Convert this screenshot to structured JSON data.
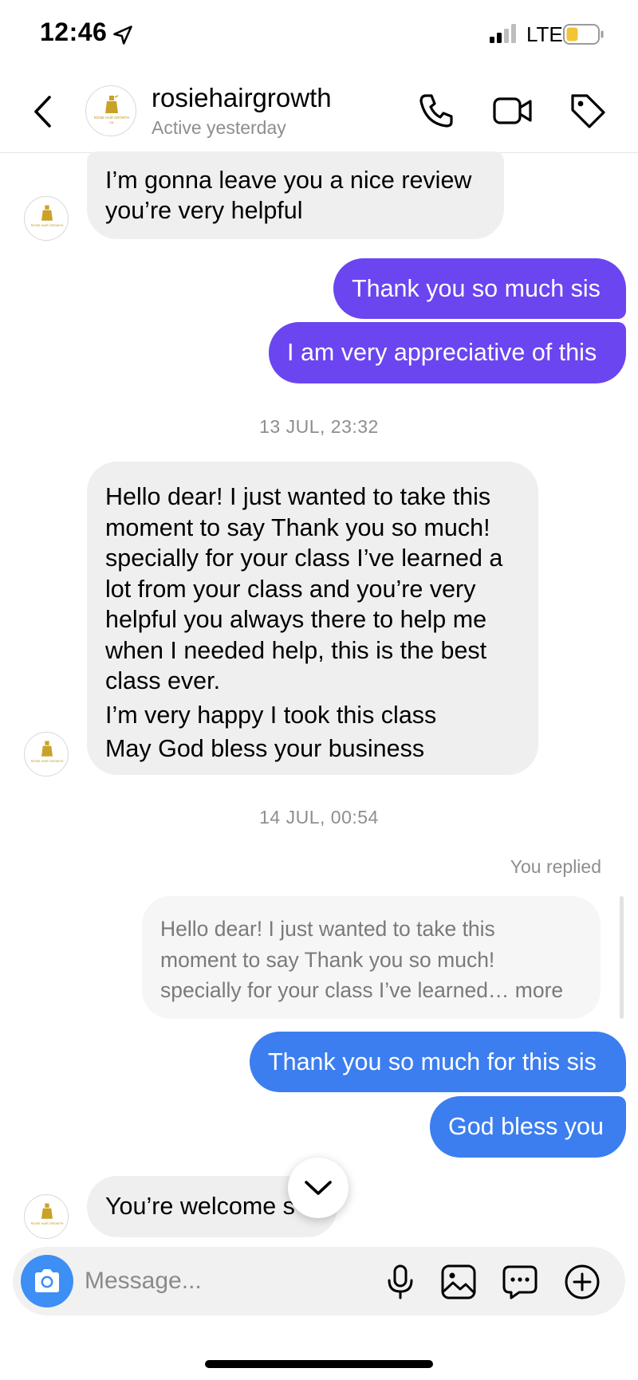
{
  "status_bar": {
    "time": "12:46",
    "network": "LTE",
    "battery_color": "#f2c436"
  },
  "header": {
    "name": "rosiehairgrowth",
    "status": "Active yesterday"
  },
  "avatar_text": {
    "line1": "ROSIE HAIR GROWTH",
    "line2": "OIL"
  },
  "icons": {
    "back": "chevron-left-icon",
    "location": "location-arrow-icon",
    "phone": "phone-icon",
    "video": "video-camera-icon",
    "tag": "tag-icon",
    "camera": "camera-icon",
    "mic": "microphone-icon",
    "gallery": "image-icon",
    "sticker": "chat-bubble-icon",
    "add": "plus-circle-icon",
    "scroll": "chevron-down-icon"
  },
  "colors": {
    "outgoing_purple": "#6a45f0",
    "outgoing_blue": "#3c7ef0",
    "incoming": "#efefef",
    "camera_button": "#3d8ef5"
  },
  "messages": {
    "m1": [
      "I’m gonna leave you a nice review",
      "you’re very helpful"
    ],
    "m2": "Thank you so much sis",
    "m3": "I am very appreciative of this",
    "ts1": "13 JUL, 23:32",
    "m4": [
      "Hello dear! I just wanted to take this",
      "moment to say Thank you so much!",
      "specially for your class I’ve learned a",
      "lot from your class and you’re very",
      "helpful you always there to help me",
      "when I needed help,  this is the best",
      "class ever.",
      "I’m very happy I took this class",
      "May God bless your business"
    ],
    "ts2": "14 JUL, 00:54",
    "replied_label": "You replied",
    "quote": [
      "Hello dear! I just wanted to take this",
      "moment to say Thank you so much!",
      "specially for your class I’ve learned… more"
    ],
    "m5": "Thank you so much for this sis",
    "m6": "God bless you",
    "m7": "You’re welcome s"
  },
  "composer": {
    "placeholder": "Message..."
  }
}
